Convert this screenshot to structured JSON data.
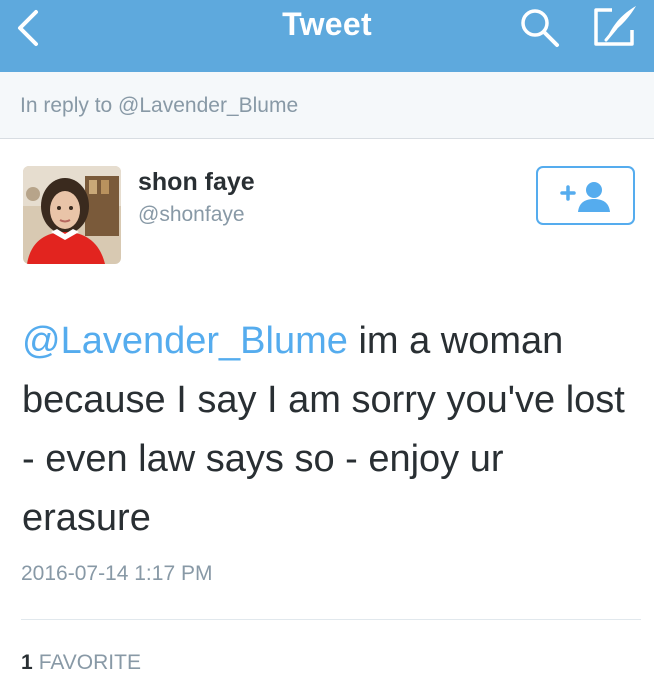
{
  "navbar": {
    "title": "Tweet",
    "back_icon": "chevron-left-icon",
    "search_icon": "search-icon",
    "compose_icon": "compose-icon",
    "background_color": "#5ea9dd"
  },
  "reply": {
    "text": "In reply to @Lavender_Blume"
  },
  "author": {
    "display_name": "shon faye",
    "handle": "@shonfaye",
    "follow_icon": "add-user-icon"
  },
  "tweet": {
    "mention": "@Lavender_Blume",
    "body": " im a woman because I say I am sorry you've lost - even law says so - enjoy ur erasure",
    "timestamp": "2016-07-14 1:17 PM"
  },
  "stats": {
    "favorites_count": "1",
    "favorites_label": "FAVORITE"
  },
  "colors": {
    "accent": "#55acee",
    "text_primary": "#292f33",
    "text_secondary": "#8899a6"
  }
}
